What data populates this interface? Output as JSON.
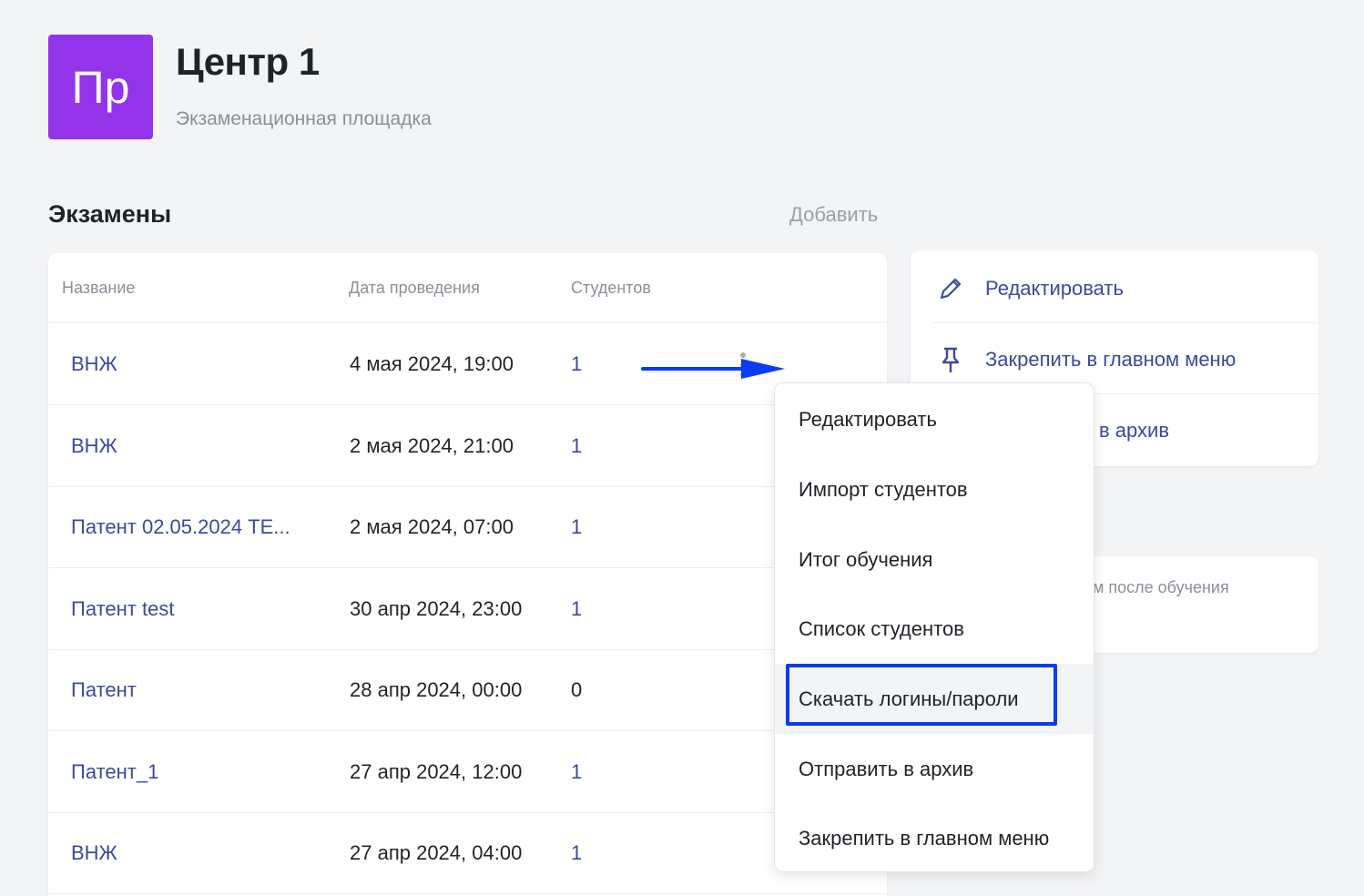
{
  "header": {
    "avatar_text": "Пр",
    "avatar_color": "#9333ea",
    "title": "Центр 1",
    "subtitle": "Экзаменационная площадка"
  },
  "exams": {
    "title": "Экзамены",
    "add_label": "Добавить",
    "columns": [
      "Название",
      "Дата проведения",
      "Студентов"
    ],
    "rows": [
      {
        "name": "ВНЖ",
        "date": "4 мая 2024, 19:00",
        "students": "1"
      },
      {
        "name": "ВНЖ",
        "date": "2 мая 2024, 21:00",
        "students": "1"
      },
      {
        "name": "Патент 02.05.2024 ТЕ...",
        "date": "2 мая 2024, 07:00",
        "students": "1"
      },
      {
        "name": "Патент test",
        "date": "30 апр 2024, 23:00",
        "students": "1"
      },
      {
        "name": "Патент",
        "date": "28 апр 2024, 00:00",
        "students": "0"
      },
      {
        "name": "Патент_1",
        "date": "27 апр 2024, 12:00",
        "students": "1"
      },
      {
        "name": "ВНЖ",
        "date": "27 апр 2024, 04:00",
        "students": "1"
      }
    ]
  },
  "side_actions": {
    "items": [
      {
        "icon": "pencil-icon",
        "label": "Редактировать"
      },
      {
        "icon": "pin-icon",
        "label": "Закрепить в главном меню"
      },
      {
        "icon": "archive-icon",
        "label": "в архив"
      }
    ],
    "hint_text": "ам после обучения"
  },
  "context_menu": {
    "items": [
      "Редактировать",
      "Импорт студентов",
      "Итог обучения",
      "Список студентов",
      "Скачать логины/пароли",
      "Отправить в архив",
      "Закрепить в главном меню"
    ],
    "highlighted_index": 4,
    "highlight_color": "#0a3bf5"
  },
  "colors": {
    "link": "#3b4a9c",
    "muted": "#8a8f99",
    "annotation": "#0a3bf5"
  }
}
